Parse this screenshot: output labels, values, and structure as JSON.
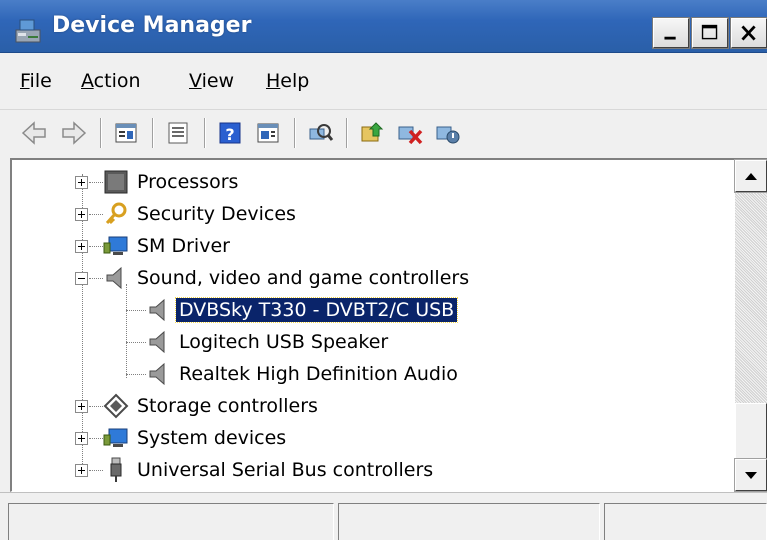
{
  "window": {
    "title": "Device Manager",
    "title_bar_color": "#2f66b8",
    "icon": "device-manager-icon",
    "caption_buttons": [
      "minimize",
      "maximize",
      "close"
    ]
  },
  "menu": {
    "items": [
      {
        "label_hot": "F",
        "label_rest": "ile"
      },
      {
        "label_hot": "A",
        "label_rest": "ction"
      },
      {
        "label_hot": "V",
        "label_rest": "iew"
      },
      {
        "label_hot": "H",
        "label_rest": "elp"
      }
    ]
  },
  "toolbar": {
    "icons": [
      "back-arrow-icon",
      "forward-arrow-icon",
      "show-hide-tree-icon",
      "properties-icon",
      "help-icon",
      "show-action-pane-icon",
      "scan-hardware-icon",
      "update-driver-icon",
      "uninstall-device-icon",
      "disable-device-icon"
    ]
  },
  "tree": {
    "nodes": [
      {
        "label": "Processors",
        "icon": "processor-icon",
        "expander": "plus"
      },
      {
        "label": "Security Devices",
        "icon": "key-icon",
        "expander": "plus"
      },
      {
        "label": "SM Driver",
        "icon": "monitor-icon",
        "expander": "plus"
      },
      {
        "label": "Sound, video and game controllers",
        "icon": "speaker-icon",
        "expander": "minus"
      },
      {
        "label": "DVBSky T330 - DVBT2/C USB",
        "icon": "speaker-icon",
        "child": true,
        "selected": true
      },
      {
        "label": "Logitech USB Speaker",
        "icon": "speaker-icon",
        "child": true
      },
      {
        "label": "Realtek High Definition Audio",
        "icon": "speaker-icon",
        "child": true
      },
      {
        "label": "Storage controllers",
        "icon": "storage-icon",
        "expander": "plus"
      },
      {
        "label": "System devices",
        "icon": "monitor-icon",
        "expander": "plus"
      },
      {
        "label": "Universal Serial Bus controllers",
        "icon": "usb-icon",
        "expander": "plus"
      }
    ],
    "selection_color": "#0a246a"
  },
  "statusbar": {
    "panes": [
      "",
      "",
      ""
    ]
  }
}
